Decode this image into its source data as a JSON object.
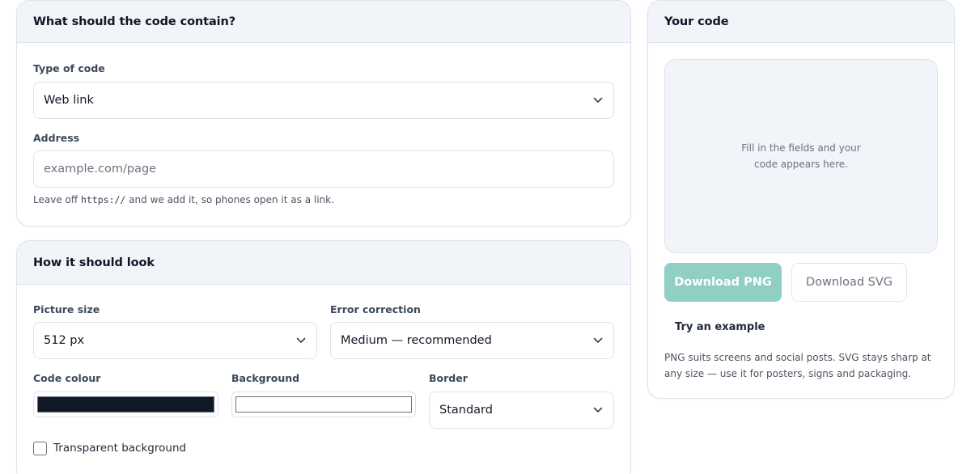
{
  "content_card": {
    "title": "What should the code contain?",
    "type_label": "Type of code",
    "type_value": "Web link",
    "address_label": "Address",
    "address_placeholder": "example.com/page",
    "hint_prefix": "Leave off",
    "hint_code": "https://",
    "hint_suffix": "and we add it, so phones open it as a link."
  },
  "look_card": {
    "title": "How it should look",
    "size_label": "Picture size",
    "size_value": "512 px",
    "error_label": "Error correction",
    "error_value": "Medium — recommended",
    "code_colour_label": "Code colour",
    "code_colour": "#111827",
    "background_label": "Background",
    "background_colour": "#ffffff",
    "border_label": "Border",
    "border_value": "Standard",
    "transparent_label": "Transparent background",
    "transparent_checked": false
  },
  "output_card": {
    "title": "Your code",
    "preview_text": "Fill in the fields and your code appears here.",
    "download_png": "Download PNG",
    "download_svg": "Download SVG",
    "try_example": "Try an example",
    "note": "PNG suits screens and social posts. SVG stays sharp at any size — use it for posters, signs and packaging."
  },
  "colors": {
    "accent": "#8fcfc6",
    "card_header_bg": "#f1f4f8",
    "border": "#dfe3ea"
  },
  "icons": {
    "select_chevron": "chevron-down-icon"
  }
}
